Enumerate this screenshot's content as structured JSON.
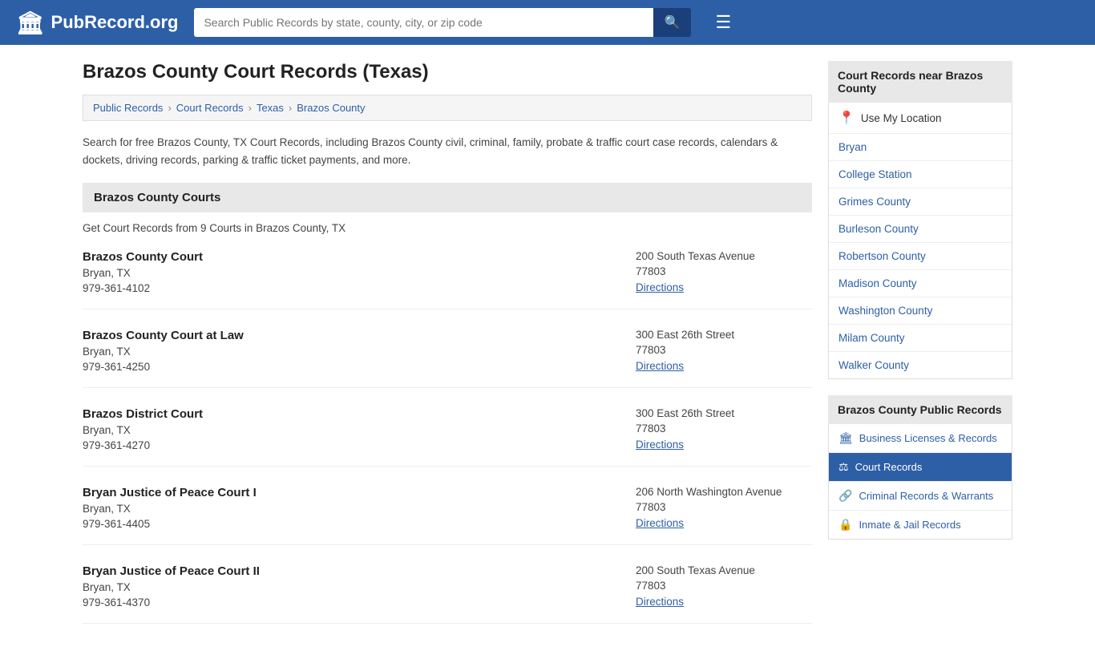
{
  "header": {
    "logo_text": "PubRecord.org",
    "search_placeholder": "Search Public Records by state, county, city, or zip code",
    "search_icon": "🔍",
    "menu_icon": "☰"
  },
  "page": {
    "title": "Brazos County Court Records (Texas)",
    "breadcrumb": [
      {
        "label": "Public Records",
        "href": "#"
      },
      {
        "label": "Court Records",
        "href": "#"
      },
      {
        "label": "Texas",
        "href": "#"
      },
      {
        "label": "Brazos County",
        "href": "#"
      }
    ],
    "description": "Search for free Brazos County, TX Court Records, including Brazos County civil, criminal, family, probate & traffic court case records, calendars & dockets, driving records, parking & traffic ticket payments, and more.",
    "section_title": "Brazos County Courts",
    "courts_count": "Get Court Records from 9 Courts in Brazos County, TX",
    "courts": [
      {
        "name": "Brazos County Court",
        "city": "Bryan, TX",
        "phone": "979-361-4102",
        "address": "200 South Texas Avenue",
        "zip": "77803",
        "directions": "Directions"
      },
      {
        "name": "Brazos County Court at Law",
        "city": "Bryan, TX",
        "phone": "979-361-4250",
        "address": "300 East 26th Street",
        "zip": "77803",
        "directions": "Directions"
      },
      {
        "name": "Brazos District Court",
        "city": "Bryan, TX",
        "phone": "979-361-4270",
        "address": "300 East 26th Street",
        "zip": "77803",
        "directions": "Directions"
      },
      {
        "name": "Bryan Justice of Peace Court I",
        "city": "Bryan, TX",
        "phone": "979-361-4405",
        "address": "206 North Washington Avenue",
        "zip": "77803",
        "directions": "Directions"
      },
      {
        "name": "Bryan Justice of Peace Court II",
        "city": "Bryan, TX",
        "phone": "979-361-4370",
        "address": "200 South Texas Avenue",
        "zip": "77803",
        "directions": "Directions"
      }
    ]
  },
  "sidebar": {
    "nearby_title": "Court Records near Brazos County",
    "use_location": "Use My Location",
    "nearby_links": [
      "Bryan",
      "College Station",
      "Grimes County",
      "Burleson County",
      "Robertson County",
      "Madison County",
      "Washington County",
      "Milam County",
      "Walker County"
    ],
    "public_records_title": "Brazos County Public Records",
    "public_records": [
      {
        "label": "Business Licenses & Records",
        "icon": "🏛",
        "active": false
      },
      {
        "label": "Court Records",
        "icon": "⚖",
        "active": true
      },
      {
        "label": "Criminal Records & Warrants",
        "icon": "🔗",
        "active": false
      },
      {
        "label": "Inmate & Jail Records",
        "icon": "🔒",
        "active": false
      }
    ]
  }
}
